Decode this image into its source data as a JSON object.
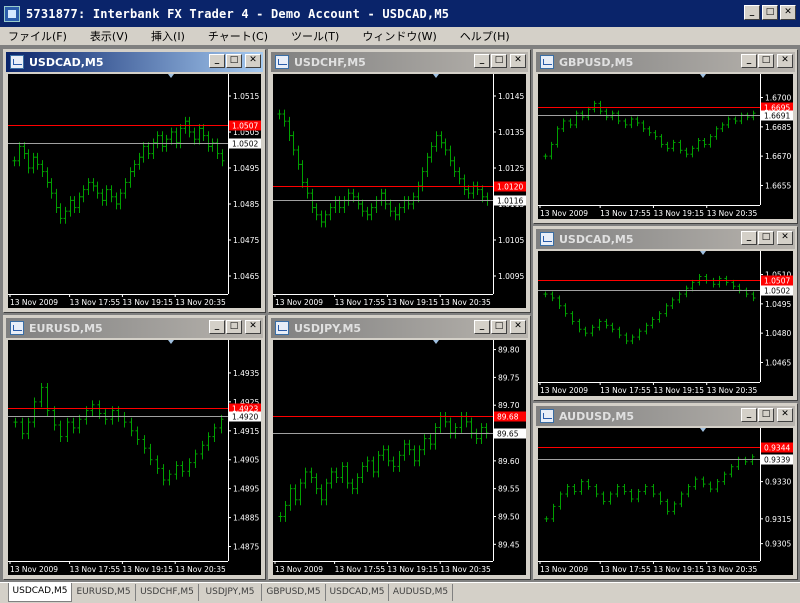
{
  "app": {
    "title": "5731877: Interbank FX Trader 4 - Demo Account - USDCAD,M5"
  },
  "window_buttons": {
    "minimize": "_",
    "maximize": "□",
    "close": "✕"
  },
  "menu": [
    {
      "label": "ファイル(F)"
    },
    {
      "label": "表示(V)"
    },
    {
      "label": "挿入(I)"
    },
    {
      "label": "チャート(C)"
    },
    {
      "label": "ツール(T)"
    },
    {
      "label": "ウィンドウ(W)"
    },
    {
      "label": "ヘルプ(H)"
    }
  ],
  "charts": [
    {
      "id": "usdcad1",
      "title": "USDCAD,M5",
      "active": true,
      "yticks": [
        "1.0515",
        "1.0505",
        "1.0495",
        "1.0485",
        "1.0475",
        "1.0465"
      ],
      "xticks": [
        "13 Nov 2009",
        "13 Nov 17:55",
        "13 Nov 19:15",
        "13 Nov 20:35"
      ],
      "ask": "1.0507",
      "bid": "1.0502",
      "chart_data": {
        "type": "bar",
        "symbol": "USDCAD",
        "timeframe": "M5",
        "ylim": [
          1.046,
          1.052
        ],
        "ask": 1.0507,
        "bid": 1.0502,
        "closes": [
          1.0497,
          1.0501,
          1.0499,
          1.0495,
          1.0498,
          1.0496,
          1.0494,
          1.0491,
          1.0488,
          1.0484,
          1.0481,
          1.0483,
          1.0486,
          1.0484,
          1.0487,
          1.0489,
          1.0491,
          1.049,
          1.0488,
          1.0486,
          1.0489,
          1.0487,
          1.0485,
          1.0488,
          1.0491,
          1.0494,
          1.0496,
          1.0498,
          1.0501,
          1.0499,
          1.0502,
          1.0504,
          1.0501,
          1.0503,
          1.0505,
          1.0502,
          1.0506,
          1.0508,
          1.0505,
          1.0503,
          1.0506,
          1.0504,
          1.0501,
          1.0502,
          1.0499,
          1.0497
        ]
      }
    },
    {
      "id": "usdchf",
      "title": "USDCHF,M5",
      "active": false,
      "yticks": [
        "1.0145",
        "1.0135",
        "1.0125",
        "1.0115",
        "1.0105",
        "1.0095"
      ],
      "xticks": [
        "13 Nov 2009",
        "13 Nov 17:55",
        "13 Nov 19:15",
        "13 Nov 20:35"
      ],
      "ask": "1.0120",
      "bid": "1.0116",
      "chart_data": {
        "type": "bar",
        "symbol": "USDCHF",
        "timeframe": "M5",
        "ylim": [
          1.009,
          1.015
        ],
        "ask": 1.012,
        "bid": 1.0116,
        "closes": [
          1.014,
          1.0138,
          1.0134,
          1.013,
          1.0126,
          1.0121,
          1.0118,
          1.0114,
          1.0112,
          1.011,
          1.0112,
          1.0114,
          1.0116,
          1.0114,
          1.0116,
          1.0118,
          1.0117,
          1.0115,
          1.0113,
          1.0112,
          1.0114,
          1.0116,
          1.0118,
          1.0115,
          1.0113,
          1.0112,
          1.0114,
          1.0116,
          1.0115,
          1.0117,
          1.012,
          1.0124,
          1.0128,
          1.0131,
          1.0134,
          1.0132,
          1.013,
          1.0127,
          1.0124,
          1.0122,
          1.0119,
          1.0118,
          1.012,
          1.0119,
          1.0117,
          1.0116
        ]
      }
    },
    {
      "id": "gbpusd",
      "title": "GBPUSD,M5",
      "active": false,
      "yticks": [
        "1.6700",
        "1.6685",
        "1.6670",
        "1.6655"
      ],
      "xticks": [
        "13 Nov 2009",
        "13 Nov 17:55",
        "13 Nov 19:15",
        "13 Nov 20:35"
      ],
      "ask": "1.6695",
      "bid": "1.6691",
      "chart_data": {
        "type": "bar",
        "symbol": "GBPUSD",
        "timeframe": "M5",
        "ylim": [
          1.6645,
          1.671
        ],
        "ask": 1.6695,
        "bid": 1.6691,
        "closes": [
          1.667,
          1.6676,
          1.6684,
          1.6688,
          1.6686,
          1.6692,
          1.669,
          1.6694,
          1.6697,
          1.6693,
          1.669,
          1.6692,
          1.6688,
          1.6686,
          1.6689,
          1.6687,
          1.6684,
          1.6682,
          1.668,
          1.6676,
          1.6674,
          1.6677,
          1.6673,
          1.6671,
          1.6674,
          1.6678,
          1.6676,
          1.668,
          1.6684,
          1.6686,
          1.6689,
          1.6688,
          1.6691,
          1.669,
          1.6692
        ]
      }
    },
    {
      "id": "usdcad2",
      "title": "USDCAD,M5",
      "active": false,
      "yticks": [
        "1.0510",
        "1.0495",
        "1.0480",
        "1.0465"
      ],
      "xticks": [
        "13 Nov 2009",
        "13 Nov 17:55",
        "13 Nov 19:15",
        "13 Nov 20:35"
      ],
      "ask": "1.0507",
      "bid": "1.0502",
      "chart_data": {
        "type": "bar",
        "symbol": "USDCAD",
        "timeframe": "M5",
        "ylim": [
          1.0455,
          1.052
        ],
        "ask": 1.0507,
        "bid": 1.0502,
        "closes": [
          1.05,
          1.0498,
          1.0494,
          1.049,
          1.0486,
          1.0482,
          1.048,
          1.0483,
          1.0486,
          1.0484,
          1.0482,
          1.0479,
          1.0476,
          1.0478,
          1.0481,
          1.0484,
          1.0487,
          1.049,
          1.0494,
          1.0497,
          1.05,
          1.0503,
          1.0506,
          1.0509,
          1.0507,
          1.0505,
          1.0508,
          1.0506,
          1.0504,
          1.0502,
          1.05,
          1.0498
        ]
      }
    },
    {
      "id": "eurusd",
      "title": "EURUSD,M5",
      "active": false,
      "yticks": [
        "1.4935",
        "1.4925",
        "1.4915",
        "1.4905",
        "1.4895",
        "1.4885",
        "1.4875"
      ],
      "xticks": [
        "13 Nov 2009",
        "13 Nov 17:55",
        "13 Nov 19:15",
        "13 Nov 20:35"
      ],
      "ask": "1.4923",
      "bid": "1.4920",
      "chart_data": {
        "type": "bar",
        "symbol": "EURUSD",
        "timeframe": "M5",
        "ylim": [
          1.487,
          1.4945
        ],
        "ask": 1.4923,
        "bid": 1.492,
        "closes": [
          1.4918,
          1.4914,
          1.4918,
          1.4925,
          1.493,
          1.4922,
          1.4917,
          1.4913,
          1.4918,
          1.4916,
          1.4919,
          1.4922,
          1.4924,
          1.4921,
          1.4919,
          1.4922,
          1.492,
          1.4918,
          1.4915,
          1.4912,
          1.4909,
          1.4905,
          1.4902,
          1.4898,
          1.49,
          1.4903,
          1.4901,
          1.4904,
          1.4907,
          1.491,
          1.4913,
          1.4916,
          1.4919
        ]
      }
    },
    {
      "id": "usdjpy",
      "title": "USDJPY,M5",
      "active": false,
      "yticks": [
        "89.80",
        "89.75",
        "89.70",
        "89.65",
        "89.60",
        "89.55",
        "89.50",
        "89.45"
      ],
      "xticks": [
        "13 Nov 2009",
        "13 Nov 17:55",
        "13 Nov 19:15",
        "13 Nov 20:35"
      ],
      "ask": "89.68",
      "bid": "89.65",
      "chart_data": {
        "type": "bar",
        "symbol": "USDJPY",
        "timeframe": "M5",
        "ylim": [
          89.42,
          89.81
        ],
        "ask": 89.68,
        "bid": 89.65,
        "closes": [
          89.5,
          89.52,
          89.55,
          89.53,
          89.56,
          89.58,
          89.57,
          89.55,
          89.53,
          89.56,
          89.58,
          89.57,
          89.59,
          89.56,
          89.55,
          89.57,
          89.59,
          89.6,
          89.58,
          89.61,
          89.62,
          89.6,
          89.59,
          89.61,
          89.63,
          89.62,
          89.6,
          89.62,
          89.64,
          89.63,
          89.66,
          89.68,
          89.67,
          89.65,
          89.66,
          89.68,
          89.67,
          89.65,
          89.64,
          89.66,
          89.65
        ]
      }
    },
    {
      "id": "audusd",
      "title": "AUDUSD,M5",
      "active": false,
      "yticks": [
        "0.9330",
        "0.9315",
        "0.9305"
      ],
      "xticks": [
        "13 Nov 2009",
        "13 Nov 17:55",
        "13 Nov 19:15",
        "13 Nov 20:35"
      ],
      "ask": "0.9344",
      "bid": "0.9339",
      "chart_data": {
        "type": "bar",
        "symbol": "AUDUSD",
        "timeframe": "M5",
        "ylim": [
          0.9298,
          0.935
        ],
        "ask": 0.9344,
        "bid": 0.9339,
        "closes": [
          0.9315,
          0.932,
          0.9325,
          0.9328,
          0.9326,
          0.933,
          0.9328,
          0.9325,
          0.9322,
          0.9325,
          0.9328,
          0.9326,
          0.9323,
          0.9326,
          0.9328,
          0.9325,
          0.9322,
          0.9318,
          0.9321,
          0.9325,
          0.9328,
          0.9331,
          0.9329,
          0.9327,
          0.933,
          0.9333,
          0.9336,
          0.9339,
          0.9338,
          0.934
        ]
      }
    }
  ],
  "tabs": [
    {
      "label": "USDCAD,M5",
      "active": true
    },
    {
      "label": "EURUSD,M5",
      "active": false
    },
    {
      "label": "USDCHF,M5",
      "active": false
    },
    {
      "label": "USDJPY,M5",
      "active": false
    },
    {
      "label": "GBPUSD,M5",
      "active": false
    },
    {
      "label": "USDCAD,M5",
      "active": false
    },
    {
      "label": "AUDUSD,M5",
      "active": false
    }
  ],
  "colors": {
    "bar": "#00a000",
    "ask_line": "#ff0000",
    "bid_line": "#a0a0a0",
    "axis_text": "#ffffff",
    "ask_label_bg": "#ff0000",
    "background": "#000000"
  }
}
